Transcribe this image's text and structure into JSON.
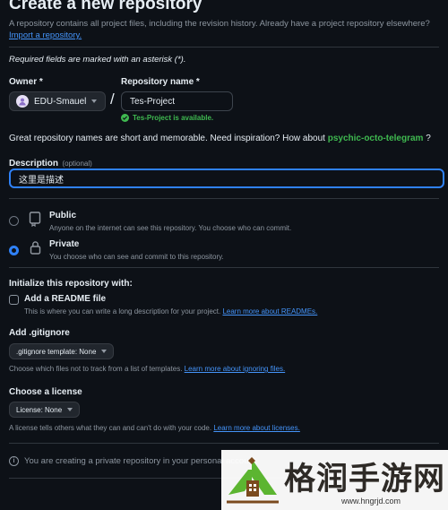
{
  "header": {
    "title": "Create a new repository",
    "subtitle": "A repository contains all project files, including the revision history. Already have a project repository elsewhere?",
    "import_link": "Import a repository."
  },
  "required_note": "Required fields are marked with an asterisk (*).",
  "owner": {
    "label": "Owner *",
    "value": "EDU-Smauel"
  },
  "separator": "/",
  "repo_name": {
    "label": "Repository name *",
    "value": "Tes-Project",
    "availability": "Tes-Project is available."
  },
  "inspiration": {
    "text": "Great repository names are short and memorable. Need inspiration? How about",
    "suggestion": "psychic-octo-telegram",
    "suffix": "?"
  },
  "description": {
    "label": "Description",
    "optional": "(optional)",
    "value": "这里是描述"
  },
  "visibility": {
    "public": {
      "label": "Public",
      "desc": "Anyone on the internet can see this repository. You choose who can commit."
    },
    "private": {
      "label": "Private",
      "desc": "You choose who can see and commit to this repository."
    },
    "selected": "private"
  },
  "initialize": {
    "heading": "Initialize this repository with:",
    "readme": {
      "label": "Add a README file",
      "desc": "This is where you can write a long description for your project.",
      "link": "Learn more about READMEs."
    }
  },
  "gitignore": {
    "heading": "Add .gitignore",
    "button": ".gitignore template: None",
    "desc": "Choose which files not to track from a list of templates.",
    "link": "Learn more about ignoring files."
  },
  "license": {
    "heading": "Choose a license",
    "button": "License: None",
    "desc": "A license tells others what they can and can't do with your code.",
    "link": "Learn more about licenses."
  },
  "notice": "You are creating a private repository in your personal account.",
  "watermark": {
    "name": "格润手游网",
    "url": "www.hngrjd.com",
    "color_green": "#5cb531",
    "color_brown": "#7a4a1e"
  }
}
